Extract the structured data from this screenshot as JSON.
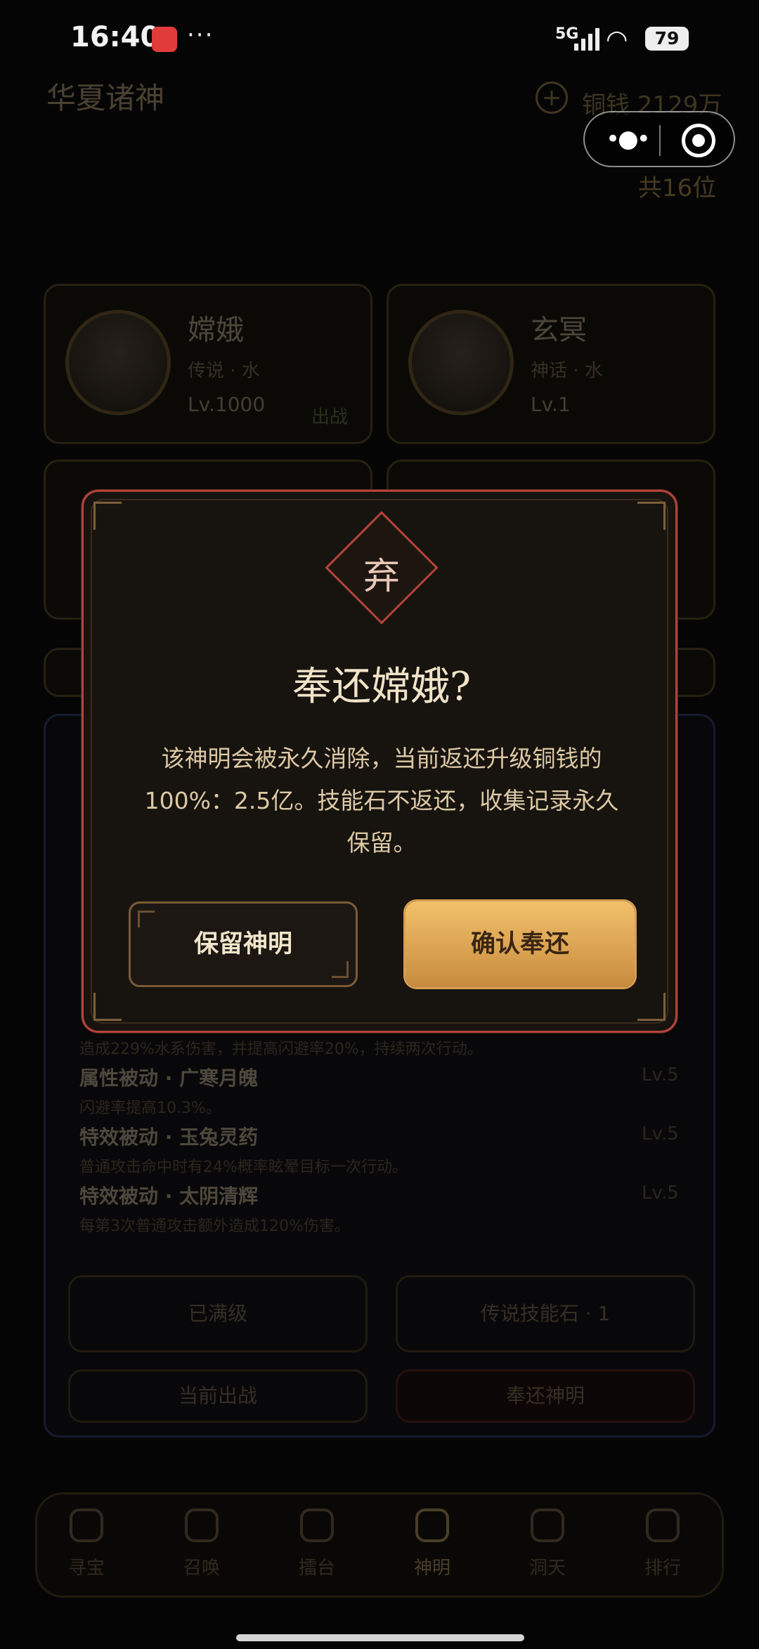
{
  "status_bar": {
    "time": "16:40",
    "network": "5G",
    "battery": "79"
  },
  "header": {
    "title": "华夏诸神",
    "coin_label": "铜钱 2129万",
    "total": "共16位"
  },
  "god_cards": [
    {
      "name": "嫦娥",
      "tags": "传说 · 水",
      "level": "Lv.1000",
      "badge": "出战"
    },
    {
      "name": "玄冥",
      "tags": "神话 · 水",
      "level": "Lv.1"
    }
  ],
  "detail": {
    "partial_desc": "造成229%水系伤害，并提高闪避率20%，持续两次行动。",
    "skills": [
      {
        "title": "属性被动 · 广寒月魄",
        "level": "Lv.5",
        "desc": "闪避率提高10.3%。"
      },
      {
        "title": "特效被动 · 玉兔灵药",
        "level": "Lv.5",
        "desc": "普通攻击命中时有24%概率眩晕目标一次行动。"
      },
      {
        "title": "特效被动 · 太阴清辉",
        "level": "Lv.5",
        "desc": "每第3次普通攻击额外造成120%伤害。"
      }
    ],
    "buttons": {
      "maxed": "已满级",
      "stone": "传说技能石 · 1",
      "current": "当前出战",
      "return_god": "奉还神明"
    }
  },
  "nav": [
    {
      "label": "寻宝"
    },
    {
      "label": "召唤"
    },
    {
      "label": "擂台"
    },
    {
      "label": "神明",
      "active": true
    },
    {
      "label": "洞天"
    },
    {
      "label": "排行"
    }
  ],
  "modal": {
    "icon_char": "弃",
    "title": "奉还嫦娥?",
    "body": "该神明会被永久消除，当前返还升级铜钱的100%：2.5亿。技能石不返还，收集记录永久保留。",
    "keep_label": "保留神明",
    "confirm_label": "确认奉还"
  },
  "colors": {
    "accent_gold": "#d9b56c",
    "danger_red": "#b4433a"
  }
}
